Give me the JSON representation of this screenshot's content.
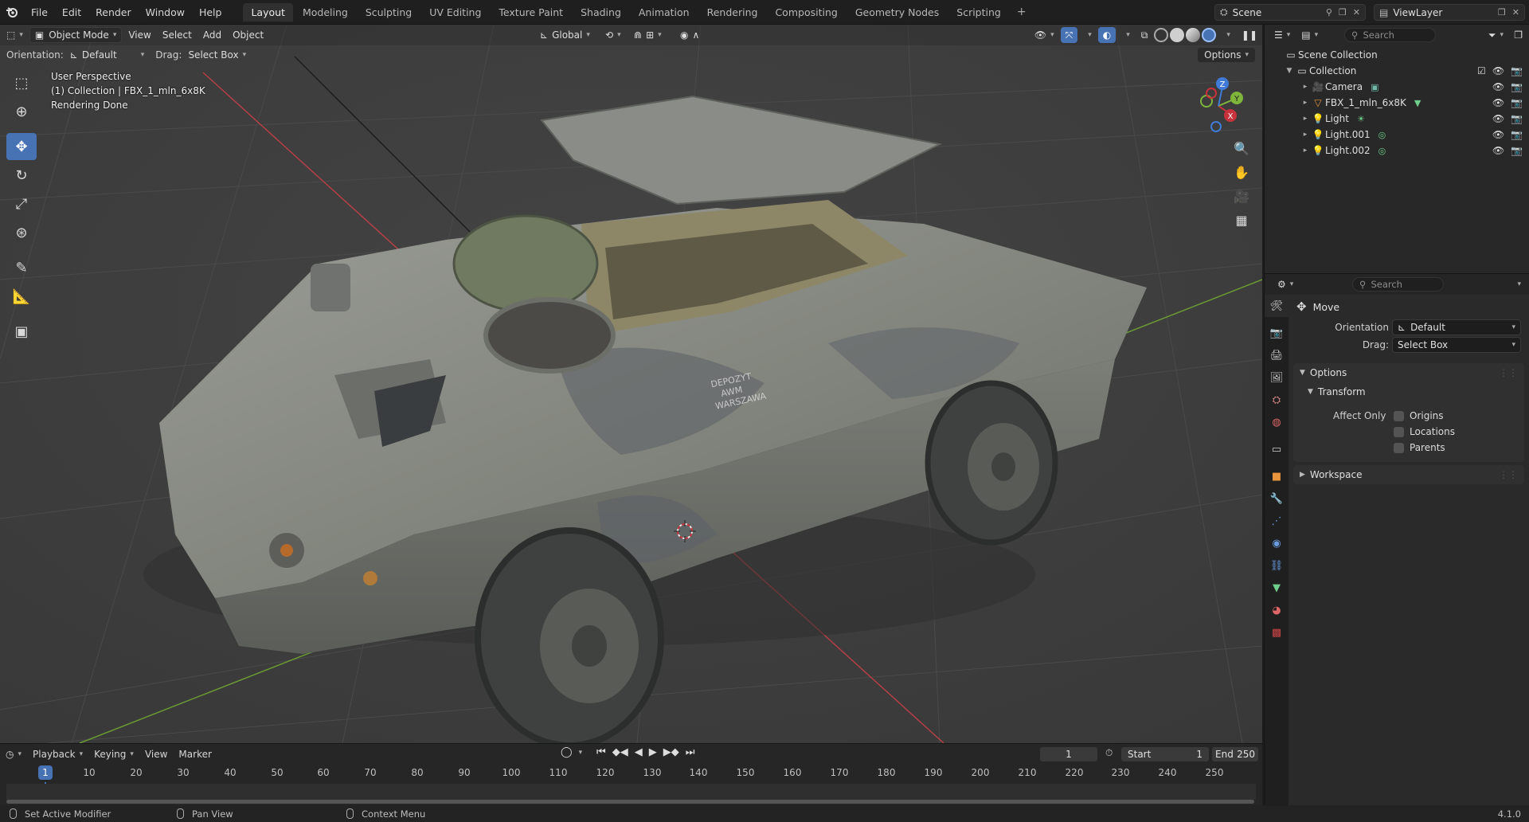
{
  "menu": {
    "items": [
      "File",
      "Edit",
      "Render",
      "Window",
      "Help"
    ]
  },
  "workspaces": {
    "tabs": [
      "Layout",
      "Modeling",
      "Sculpting",
      "UV Editing",
      "Texture Paint",
      "Shading",
      "Animation",
      "Rendering",
      "Compositing",
      "Geometry Nodes",
      "Scripting"
    ],
    "active": "Layout"
  },
  "scene": {
    "name": "Scene",
    "view_layer": "ViewLayer"
  },
  "viewport": {
    "mode": "Object Mode",
    "menus": [
      "View",
      "Select",
      "Add",
      "Object"
    ],
    "transform_orientation": "Global",
    "tool_settings": {
      "orientation_label": "Orientation:",
      "orientation_value": "Default",
      "drag_label": "Drag:",
      "drag_value": "Select Box"
    },
    "options_label": "Options",
    "info": {
      "line1": "User Perspective",
      "line2": "(1) Collection | FBX_1_mln_6x8K",
      "line3": "Rendering Done"
    },
    "model_text": [
      "DEPOZYT",
      "AWM",
      "WARSZAWA"
    ]
  },
  "timeline": {
    "menus": [
      "Playback",
      "Keying",
      "View",
      "Marker"
    ],
    "current_frame": "1",
    "start_label": "Start",
    "start": "1",
    "end_label": "End",
    "end": "250",
    "ticks": [
      "10",
      "20",
      "30",
      "40",
      "50",
      "60",
      "70",
      "80",
      "90",
      "100",
      "110",
      "120",
      "130",
      "140",
      "150",
      "160",
      "170",
      "180",
      "190",
      "200",
      "210",
      "220",
      "230",
      "240",
      "250"
    ]
  },
  "statusbar": {
    "items": [
      "Set Active Modifier",
      "Pan View",
      "Context Menu"
    ],
    "version": "4.1.0"
  },
  "outliner": {
    "search_placeholder": "Search",
    "root": "Scene Collection",
    "collection": "Collection",
    "objects": [
      "Camera",
      "FBX_1_mln_6x8K",
      "Light",
      "Light.001",
      "Light.002"
    ]
  },
  "properties": {
    "search_placeholder": "Search",
    "tool_name": "Move",
    "orientation_label": "Orientation",
    "orientation_value": "Default",
    "drag_label": "Drag:",
    "drag_value": "Select Box",
    "options_panel": "Options",
    "transform_panel": "Transform",
    "affect_only_label": "Affect Only",
    "affect_only": [
      "Origins",
      "Locations",
      "Parents"
    ],
    "workspace_panel": "Workspace"
  },
  "colors": {
    "accent": "#4772b3",
    "x_axis": "#c8323c",
    "y_axis": "#7fb53a",
    "z_axis": "#3f7bd6"
  }
}
